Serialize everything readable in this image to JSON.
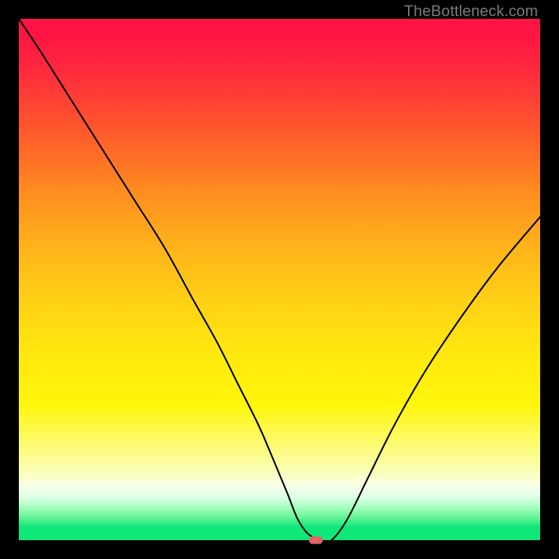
{
  "watermark": "TheBottleneck.com",
  "chart_data": {
    "type": "line",
    "title": "",
    "xlabel": "",
    "ylabel": "",
    "xlim": [
      0,
      100
    ],
    "ylim": [
      0,
      100
    ],
    "grid": false,
    "x": [
      0,
      4,
      10,
      16,
      22,
      28,
      33.5,
      38,
      42,
      46,
      49,
      51.5,
      53.5,
      55.5,
      58,
      60,
      63,
      67,
      72,
      78,
      85,
      92,
      100
    ],
    "values": [
      100,
      94,
      84.5,
      75,
      65.5,
      56,
      46,
      38,
      30,
      22,
      15,
      9,
      4,
      1.2,
      0,
      0,
      4,
      12,
      22,
      32.5,
      43,
      52.5,
      62
    ],
    "marker": {
      "x": 57,
      "y": 0
    },
    "gradient_stops": [
      {
        "pos": 0,
        "color": "#ff1443"
      },
      {
        "pos": 33,
        "color": "#ff8c1f"
      },
      {
        "pos": 66,
        "color": "#ffe80e"
      },
      {
        "pos": 95,
        "color": "#6af598"
      },
      {
        "pos": 100,
        "color": "#0fe878"
      }
    ]
  }
}
